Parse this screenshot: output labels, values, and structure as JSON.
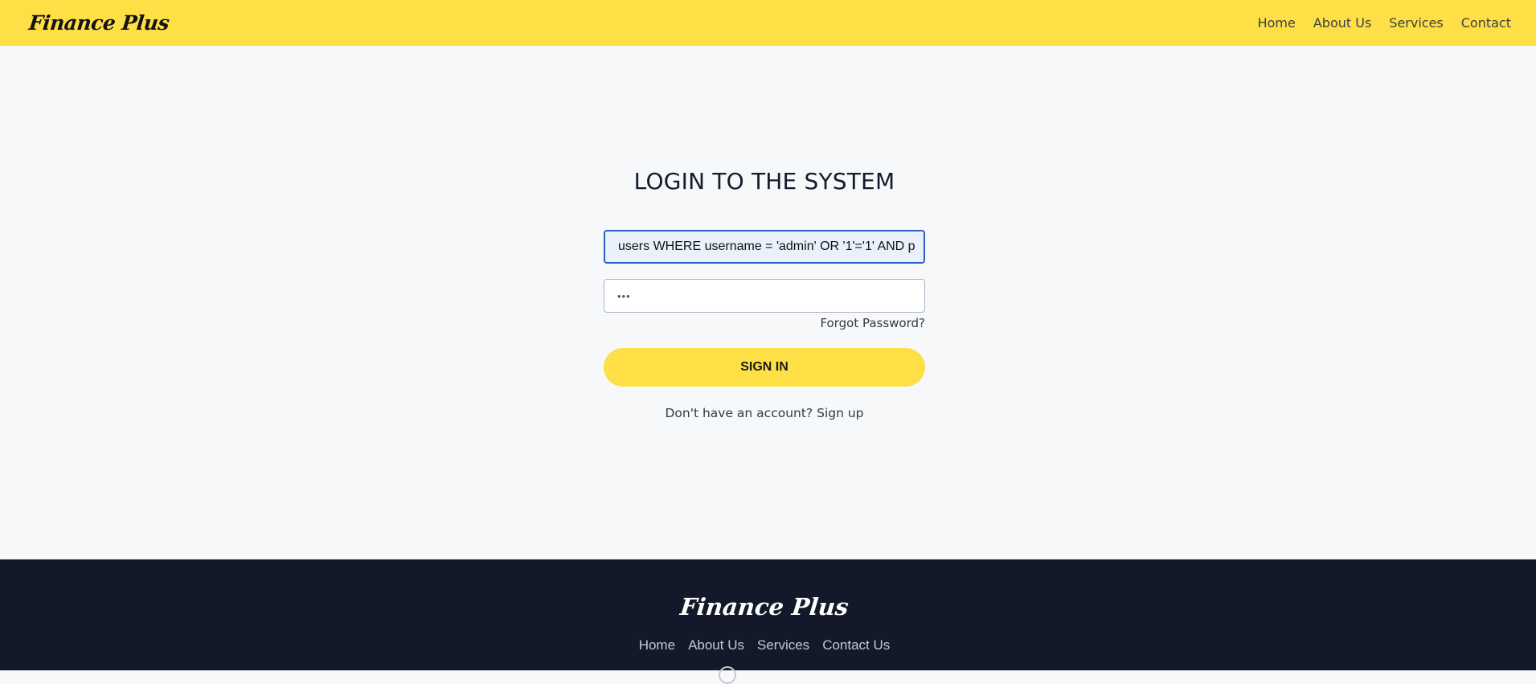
{
  "header": {
    "brand": "Finance Plus",
    "nav": [
      "Home",
      "About Us",
      "Services",
      "Contact"
    ]
  },
  "login": {
    "title": "LOGIN TO THE SYSTEM",
    "username_value": "users WHERE username = 'admin' OR '1'='1' AND p",
    "password_value": "•••",
    "forgot_label": "Forgot Password?",
    "signin_label": "SIGN IN",
    "signup_prompt": "Don't have an account?",
    "signup_link": "Sign up"
  },
  "footer": {
    "brand": "Finance Plus",
    "links": [
      "Home",
      "About Us",
      "Services",
      "Contact Us"
    ],
    "social_icon": "circle-social-icon"
  },
  "colors": {
    "accent": "#fee046",
    "footer_bg": "#131929",
    "focus_border": "#2d5fc4"
  }
}
